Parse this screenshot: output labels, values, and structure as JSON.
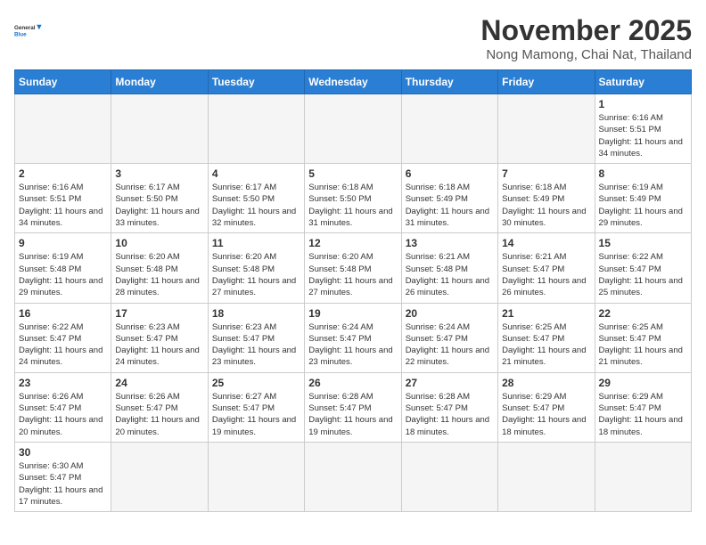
{
  "header": {
    "logo_general": "General",
    "logo_blue": "Blue",
    "month": "November 2025",
    "location": "Nong Mamong, Chai Nat, Thailand"
  },
  "weekdays": [
    "Sunday",
    "Monday",
    "Tuesday",
    "Wednesday",
    "Thursday",
    "Friday",
    "Saturday"
  ],
  "days": {
    "d1": {
      "num": "1",
      "sunrise": "6:16 AM",
      "sunset": "5:51 PM",
      "daylight": "11 hours and 34 minutes."
    },
    "d2": {
      "num": "2",
      "sunrise": "6:16 AM",
      "sunset": "5:51 PM",
      "daylight": "11 hours and 34 minutes."
    },
    "d3": {
      "num": "3",
      "sunrise": "6:17 AM",
      "sunset": "5:50 PM",
      "daylight": "11 hours and 33 minutes."
    },
    "d4": {
      "num": "4",
      "sunrise": "6:17 AM",
      "sunset": "5:50 PM",
      "daylight": "11 hours and 32 minutes."
    },
    "d5": {
      "num": "5",
      "sunrise": "6:18 AM",
      "sunset": "5:50 PM",
      "daylight": "11 hours and 31 minutes."
    },
    "d6": {
      "num": "6",
      "sunrise": "6:18 AM",
      "sunset": "5:49 PM",
      "daylight": "11 hours and 31 minutes."
    },
    "d7": {
      "num": "7",
      "sunrise": "6:18 AM",
      "sunset": "5:49 PM",
      "daylight": "11 hours and 30 minutes."
    },
    "d8": {
      "num": "8",
      "sunrise": "6:19 AM",
      "sunset": "5:49 PM",
      "daylight": "11 hours and 29 minutes."
    },
    "d9": {
      "num": "9",
      "sunrise": "6:19 AM",
      "sunset": "5:48 PM",
      "daylight": "11 hours and 29 minutes."
    },
    "d10": {
      "num": "10",
      "sunrise": "6:20 AM",
      "sunset": "5:48 PM",
      "daylight": "11 hours and 28 minutes."
    },
    "d11": {
      "num": "11",
      "sunrise": "6:20 AM",
      "sunset": "5:48 PM",
      "daylight": "11 hours and 27 minutes."
    },
    "d12": {
      "num": "12",
      "sunrise": "6:20 AM",
      "sunset": "5:48 PM",
      "daylight": "11 hours and 27 minutes."
    },
    "d13": {
      "num": "13",
      "sunrise": "6:21 AM",
      "sunset": "5:48 PM",
      "daylight": "11 hours and 26 minutes."
    },
    "d14": {
      "num": "14",
      "sunrise": "6:21 AM",
      "sunset": "5:47 PM",
      "daylight": "11 hours and 26 minutes."
    },
    "d15": {
      "num": "15",
      "sunrise": "6:22 AM",
      "sunset": "5:47 PM",
      "daylight": "11 hours and 25 minutes."
    },
    "d16": {
      "num": "16",
      "sunrise": "6:22 AM",
      "sunset": "5:47 PM",
      "daylight": "11 hours and 24 minutes."
    },
    "d17": {
      "num": "17",
      "sunrise": "6:23 AM",
      "sunset": "5:47 PM",
      "daylight": "11 hours and 24 minutes."
    },
    "d18": {
      "num": "18",
      "sunrise": "6:23 AM",
      "sunset": "5:47 PM",
      "daylight": "11 hours and 23 minutes."
    },
    "d19": {
      "num": "19",
      "sunrise": "6:24 AM",
      "sunset": "5:47 PM",
      "daylight": "11 hours and 23 minutes."
    },
    "d20": {
      "num": "20",
      "sunrise": "6:24 AM",
      "sunset": "5:47 PM",
      "daylight": "11 hours and 22 minutes."
    },
    "d21": {
      "num": "21",
      "sunrise": "6:25 AM",
      "sunset": "5:47 PM",
      "daylight": "11 hours and 21 minutes."
    },
    "d22": {
      "num": "22",
      "sunrise": "6:25 AM",
      "sunset": "5:47 PM",
      "daylight": "11 hours and 21 minutes."
    },
    "d23": {
      "num": "23",
      "sunrise": "6:26 AM",
      "sunset": "5:47 PM",
      "daylight": "11 hours and 20 minutes."
    },
    "d24": {
      "num": "24",
      "sunrise": "6:26 AM",
      "sunset": "5:47 PM",
      "daylight": "11 hours and 20 minutes."
    },
    "d25": {
      "num": "25",
      "sunrise": "6:27 AM",
      "sunset": "5:47 PM",
      "daylight": "11 hours and 19 minutes."
    },
    "d26": {
      "num": "26",
      "sunrise": "6:28 AM",
      "sunset": "5:47 PM",
      "daylight": "11 hours and 19 minutes."
    },
    "d27": {
      "num": "27",
      "sunrise": "6:28 AM",
      "sunset": "5:47 PM",
      "daylight": "11 hours and 18 minutes."
    },
    "d28": {
      "num": "28",
      "sunrise": "6:29 AM",
      "sunset": "5:47 PM",
      "daylight": "11 hours and 18 minutes."
    },
    "d29": {
      "num": "29",
      "sunrise": "6:29 AM",
      "sunset": "5:47 PM",
      "daylight": "11 hours and 18 minutes."
    },
    "d30": {
      "num": "30",
      "sunrise": "6:30 AM",
      "sunset": "5:47 PM",
      "daylight": "11 hours and 17 minutes."
    }
  },
  "labels": {
    "sunrise": "Sunrise:",
    "sunset": "Sunset:",
    "daylight": "Daylight:"
  }
}
